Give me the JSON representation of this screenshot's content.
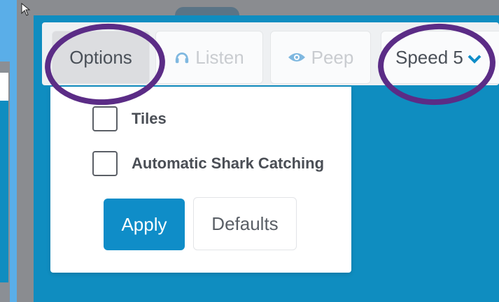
{
  "toolbar": {
    "options_label": "Options",
    "listen_label": "Listen",
    "peep_label": "Peep",
    "speed_label": "Speed 5"
  },
  "dropdown": {
    "options": [
      {
        "label": "Tiles",
        "checked": false
      },
      {
        "label": "Automatic Shark Catching",
        "checked": false
      }
    ],
    "apply_label": "Apply",
    "defaults_label": "Defaults"
  },
  "colors": {
    "accent": "#0f8dc8",
    "annotation": "#5b2c86",
    "panel": "#0f8dc0"
  }
}
